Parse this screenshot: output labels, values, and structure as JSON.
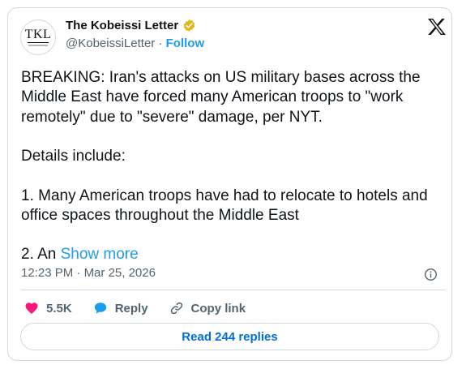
{
  "author": {
    "name": "The Kobeissi Letter",
    "handle": "@KobeissiLetter",
    "separator": "·",
    "follow_label": "Follow",
    "avatar_text": "TKL",
    "verified_badge_color": "#e2b719"
  },
  "tweet": {
    "paragraph1": "BREAKING: Iran's attacks on US military bases across the Middle East have forced many American troops to \"work remotely\" due to \"severe\" damage, per NYT.",
    "paragraph2": "Details include:",
    "paragraph3": "1. Many American troops have had to relocate to hotels and office spaces throughout the Middle East",
    "paragraph4_start": "2. An ",
    "show_more_label": "Show more"
  },
  "meta": {
    "time": "12:23 PM",
    "separator": "·",
    "date": "Mar 25, 2026"
  },
  "actions": {
    "like_count": "5.5K",
    "reply_label": "Reply",
    "copy_link_label": "Copy link"
  },
  "replies_button": {
    "label": "Read 244 replies"
  },
  "colors": {
    "accent": "#1d9bf0",
    "like": "#f91880",
    "muted": "#536471",
    "border": "#cfd9de"
  },
  "icons": [
    "verified-badge-icon",
    "x-logo-icon",
    "info-icon",
    "heart-icon",
    "reply-bubble-icon",
    "link-icon"
  ]
}
